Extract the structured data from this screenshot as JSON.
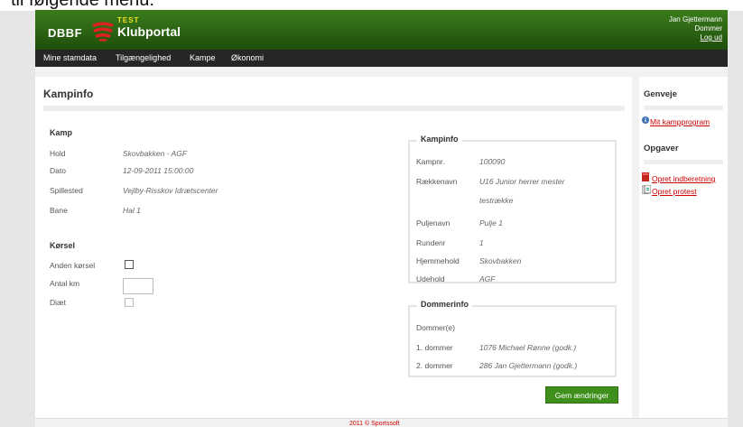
{
  "caption": "til følgende menu:",
  "header": {
    "logo_left": "DBBF",
    "logo_test": "TEST",
    "logo_title": "Klubportal",
    "user_name": "Jan Gjettermann",
    "user_role": "Dommer",
    "logout": "Log ud"
  },
  "nav": [
    "Mine stamdata",
    "Tilgængelighed",
    "Kampe",
    "Økonomi"
  ],
  "page_title": "Kampinfo",
  "kamp": {
    "heading": "Kamp",
    "rows": [
      {
        "label": "Hold",
        "value": "Skovbakken - AGF"
      },
      {
        "label": "Dato",
        "value": "12-09-2011 15:00:00"
      },
      {
        "label": "Spillested",
        "value": "Vejlby-Risskov Idrætscenter"
      },
      {
        "label": "Bane",
        "value": "Hal 1"
      }
    ]
  },
  "korsel": {
    "heading": "Kørsel",
    "anden_korsel": "Anden kørsel",
    "antal_km": "Antal km",
    "antal_km_value": "",
    "diaet": "Diæt"
  },
  "kampinfo": {
    "legend": "Kampinfo",
    "rows": [
      {
        "label": "Kampnr.",
        "value": "100090"
      },
      {
        "label": "Rækkenavn",
        "value": "U16 Junior herrer mester"
      },
      {
        "label": "",
        "value": "testrække"
      },
      {
        "label": "Puljenavn",
        "value": "Pulje 1"
      },
      {
        "label": "Rundenr",
        "value": "1"
      },
      {
        "label": "Hjemmehold",
        "value": "Skovbakken"
      },
      {
        "label": "Udehold",
        "value": "AGF"
      }
    ]
  },
  "dommerinfo": {
    "legend": "Dommerinfo",
    "sub": "Dommer(e)",
    "rows": [
      {
        "label": "1. dommer",
        "value": "1076 Michael Rønne (godk.)"
      },
      {
        "label": "2. dommer",
        "value": "286 Jan Gjettermann (godk.)"
      }
    ]
  },
  "save_button": "Gem ændringer",
  "sidebar": {
    "genveje": "Genveje",
    "mit_kampprogram": "Mit kampprogram",
    "opgaver": "Opgaver",
    "opret_indberetning": "Opret indberetning",
    "opret_protest": "Opret protest"
  },
  "footer": "2011 © Sportssoft",
  "colors": {
    "header_green": "#2f6a15",
    "nav_dark": "#262626",
    "button_green": "#3f8f1d",
    "link_red": "#cc0000"
  }
}
